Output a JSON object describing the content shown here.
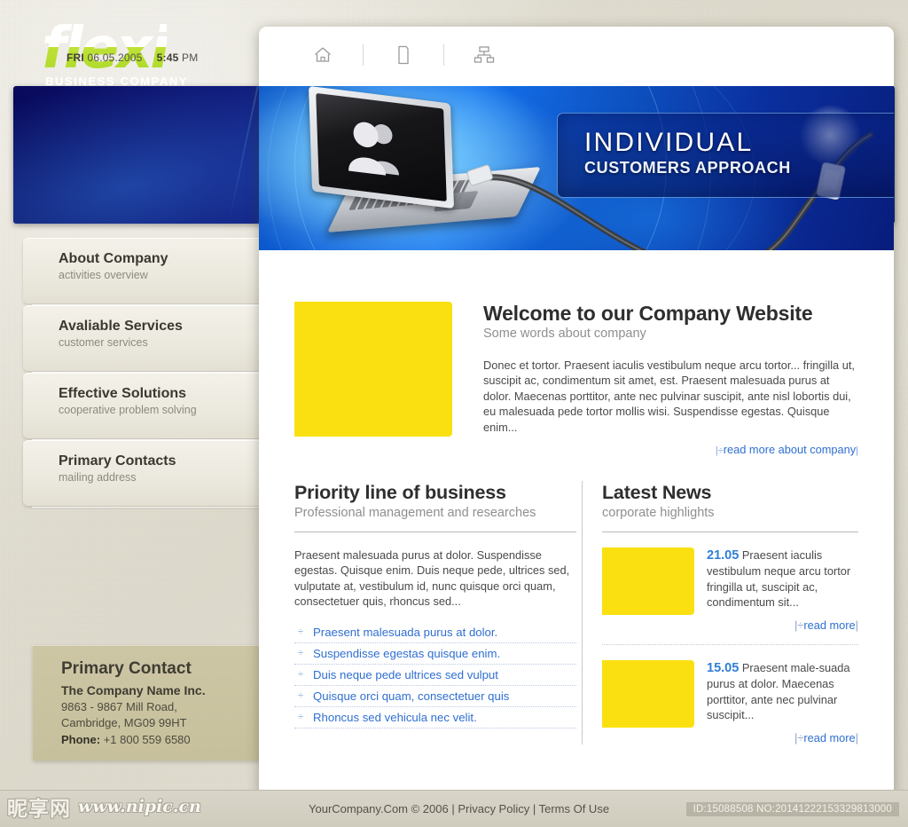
{
  "meta": {
    "date_day": "FRI",
    "date_value": "06.05.2005",
    "time_value": "5:45",
    "time_ampm": "PM"
  },
  "brand": {
    "name": "flexi",
    "tagline": "BUSINESS COMPANY",
    "accent_green": "#aed928",
    "header_blue": "#0d1170",
    "link_blue": "#2f6fd0",
    "placeholder_yellow": "#fae011"
  },
  "topbar": {
    "icons": [
      {
        "name": "home-icon",
        "label": "Home"
      },
      {
        "name": "page-icon",
        "label": "Page"
      },
      {
        "name": "sitemap-icon",
        "label": "Sitemap"
      }
    ]
  },
  "hero": {
    "title": "INDIVIDUAL",
    "subtitle": "CUSTOMERS APPROACH"
  },
  "sidebar": {
    "items": [
      {
        "title": "About Company",
        "sub": "activities overview"
      },
      {
        "title": "Avaliable Services",
        "sub": "customer services"
      },
      {
        "title": "Effective Solutions",
        "sub": "cooperative problem solving"
      },
      {
        "title": "Primary Contacts",
        "sub": "mailing address"
      }
    ],
    "contact": {
      "heading": "Primary Contact",
      "company": "The Company Name Inc.",
      "address1": "9863 - 9867 Mill Road,",
      "address2": "Cambridge, MG09 99HT",
      "phone_label": "Phone:",
      "phone_value": "+1 800 559 6580"
    }
  },
  "welcome": {
    "title": "Welcome to our Company Website",
    "subtitle": "Some words about company",
    "body": "Donec et tortor. Praesent iaculis vestibulum neque arcu tortor... fringilla ut, suscipit ac, condimentum sit amet, est. Praesent malesuada purus at dolor. Maecenas porttitor, ante nec pulvinar suscipit, ante nisl lobortis dui, eu malesuada pede tortor mollis wisi. Suspendisse egestas. Quisque enim...",
    "read_more": "read more about company"
  },
  "priority": {
    "title": "Priority line of business",
    "subtitle": "Professional management and researches",
    "body": "Praesent malesuada purus at dolor. Suspendisse egestas. Quisque enim. Duis neque pede, ultrices sed, vulputate at, vestibulum id, nunc quisque orci quam, consectetuer quis, rhoncus sed...",
    "links": [
      "Praesent malesuada purus at dolor.",
      "Suspendisse egestas quisque enim.",
      "Duis neque pede ultrices sed vulput",
      "Quisque orci quam, consectetuer quis",
      "Rhoncus sed vehicula nec velit."
    ]
  },
  "news": {
    "title": "Latest News",
    "subtitle": "corporate highlights",
    "read_more": "read more",
    "items": [
      {
        "date": "21.05",
        "text": "Praesent iaculis vestibulum neque arcu tortor fringilla ut, suscipit ac, condimentum sit..."
      },
      {
        "date": "15.05",
        "text": "Praesent male-suada purus at dolor. Maecenas porttitor, ante nec pulvinar suscipit..."
      }
    ]
  },
  "footer": {
    "text": "YourCompany.Com © 2006 | Privacy Policy | Terms Of Use"
  },
  "watermark": {
    "cn_text": "昵享网",
    "url_text": "www.nipic.cn",
    "id_text": "ID:15088508 NO:20141222153329813000"
  }
}
